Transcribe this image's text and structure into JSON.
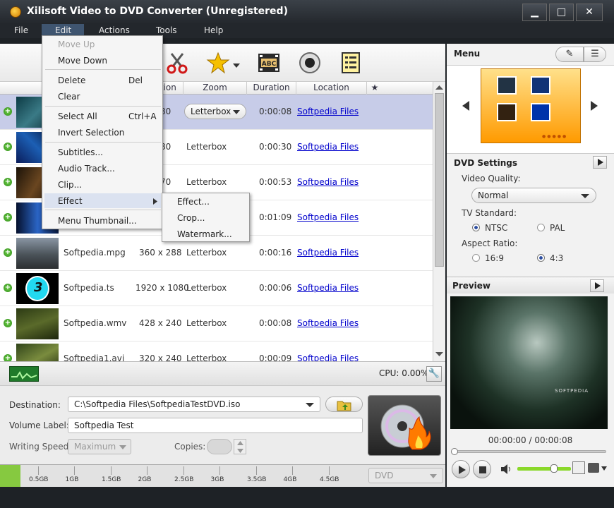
{
  "window": {
    "title": "Xilisoft Video to DVD Converter (Unregistered)"
  },
  "menubar": {
    "file": "File",
    "edit": "Edit",
    "actions": "Actions",
    "tools": "Tools",
    "help": "Help"
  },
  "edit_menu": {
    "move_up": "Move Up",
    "move_down": "Move Down",
    "delete": "Delete",
    "delete_sc": "Del",
    "clear": "Clear",
    "select_all": "Select All",
    "select_all_sc": "Ctrl+A",
    "invert_selection": "Invert Selection",
    "subtitles": "Subtitles...",
    "audio_track": "Audio Track...",
    "clip": "Clip...",
    "effect": "Effect",
    "menu_thumbnail": "Menu Thumbnail..."
  },
  "effect_submenu": {
    "effect": "Effect...",
    "crop": "Crop...",
    "watermark": "Watermark..."
  },
  "table": {
    "headers": {
      "resolution": "ution",
      "zoom": "Zoom",
      "duration": "Duration",
      "location": "Location",
      "star": "★"
    },
    "rows": [
      {
        "name": "",
        "resolution": "80",
        "zoom": "Letterbox",
        "duration": "0:00:08",
        "location": "Softpedia Files"
      },
      {
        "name": "",
        "resolution": "80",
        "zoom": "Letterbox",
        "duration": "0:00:30",
        "location": "Softpedia Files"
      },
      {
        "name": "",
        "resolution": "70",
        "zoom": "Letterbox",
        "duration": "0:00:53",
        "location": "Softpedia Files"
      },
      {
        "name": "",
        "resolution": "",
        "zoom": "",
        "duration": "0:01:09",
        "location": "Softpedia Files"
      },
      {
        "name": "Softpedia.mpg",
        "resolution": "360 x 288",
        "zoom": "Letterbox",
        "duration": "0:00:16",
        "location": "Softpedia Files"
      },
      {
        "name": "Softpedia.ts",
        "resolution": "1920 x 1080",
        "zoom": "Letterbox",
        "duration": "0:00:06",
        "location": "Softpedia Files"
      },
      {
        "name": "Softpedia.wmv",
        "resolution": "428 x 240",
        "zoom": "Letterbox",
        "duration": "0:00:08",
        "location": "Softpedia Files"
      },
      {
        "name": "Softpedia1.avi",
        "resolution": "320 x 240",
        "zoom": "Letterbox",
        "duration": "0:00:09",
        "location": "Softpedia Files"
      }
    ]
  },
  "status": {
    "cpu": "CPU: 0.00%"
  },
  "output": {
    "destination_label": "Destination:",
    "destination_value": "C:\\Softpedia Files\\SoftpediaTestDVD.iso",
    "volume_label": "Volume Label:",
    "volume_value": "Softpedia Test",
    "writing_speed_label": "Writing Speed:",
    "writing_speed_value": "Maximum",
    "copies_label": "Copies:",
    "disc_type": "DVD"
  },
  "capacity": {
    "ticks": [
      "0.5GB",
      "1GB",
      "1.5GB",
      "2GB",
      "2.5GB",
      "3GB",
      "3.5GB",
      "4GB",
      "4.5GB"
    ]
  },
  "menu_panel": {
    "title": "Menu"
  },
  "dvd_settings": {
    "title": "DVD Settings",
    "video_quality_label": "Video Quality:",
    "video_quality_value": "Normal",
    "tv_standard_label": "TV Standard:",
    "ntsc": "NTSC",
    "pal": "PAL",
    "aspect_ratio_label": "Aspect Ratio:",
    "ar_169": "16:9",
    "ar_43": "4:3"
  },
  "preview": {
    "title": "Preview",
    "time": "00:00:00 / 00:00:08",
    "watermark": "SOFTPEDIA"
  },
  "colors": {
    "accent": "#3f5570",
    "selected_row": "#c7cce8",
    "link": "#0000cc"
  }
}
